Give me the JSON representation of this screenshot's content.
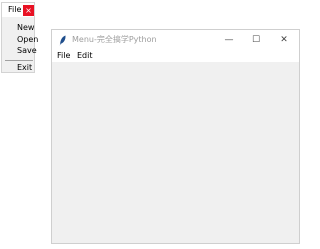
{
  "tearoff_menu": {
    "title": "File",
    "close_glyph": "×",
    "items": [
      "New",
      "Open",
      "Save"
    ],
    "exit_label": "Exit"
  },
  "window": {
    "title": "Menu-完全搞学Python",
    "icon": "feather-icon",
    "controls": {
      "minimize": "—",
      "maximize": "☐",
      "close": "✕"
    }
  },
  "menubar": {
    "items": [
      "File",
      "Edit"
    ]
  },
  "colors": {
    "close_red": "#e81123",
    "window_bg": "#f0f0f0",
    "title_text": "#9e9e9e",
    "icon_blue": "#1f4e8c"
  }
}
